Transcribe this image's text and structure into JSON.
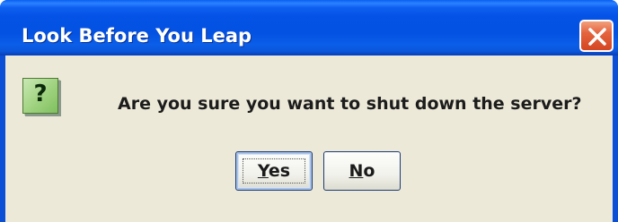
{
  "dialog": {
    "title": "Look Before You Leap",
    "icon": "question-icon",
    "icon_glyph": "?",
    "message": "Are you sure you want to shut down the server?",
    "close_icon": "close-icon",
    "buttons": [
      {
        "label_mnemonic": "Y",
        "label_rest": "es",
        "is_default": true
      },
      {
        "label_mnemonic": "N",
        "label_rest": "o",
        "is_default": false
      }
    ]
  },
  "colors": {
    "titlebar": "#0553e6",
    "body": "#ece9d8",
    "close_button": "#e4643e",
    "question_icon": "#9fd27f"
  }
}
